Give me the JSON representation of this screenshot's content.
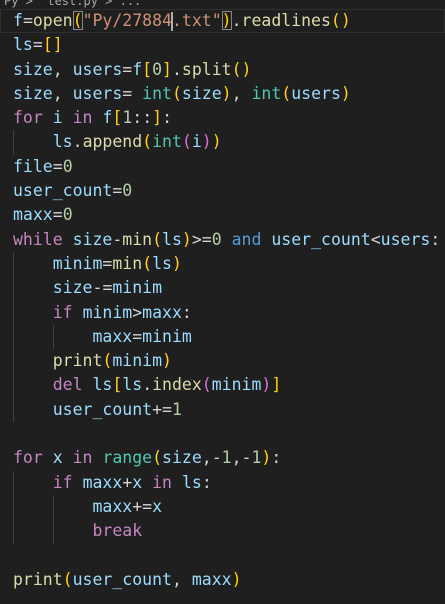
{
  "breadcrumb": {
    "text": "Py >  test.py > ..."
  },
  "editor": {
    "language": "python",
    "lines": [
      "f=open(\"Py/27884.txt\").readlines()",
      "ls=[]",
      "size, users=f[0].split()",
      "size, users= int(size), int(users)",
      "for i in f[1::]:",
      "    ls.append(int(i))",
      "file=0",
      "user_count=0",
      "maxx=0",
      "while size-min(ls)>=0 and user_count<users:",
      "    minim=min(ls)",
      "    size-=minim",
      "    if minim>maxx:",
      "        maxx=minim",
      "    print(minim)",
      "    del ls[ls.index(minim)]",
      "    user_count+=1",
      "",
      "for x in range(size,-1,-1):",
      "    if maxx+x in ls:",
      "        maxx+=x",
      "        break",
      "",
      "print(user_count, maxx)"
    ]
  },
  "colors": {
    "background": "#1f1f1f",
    "keyword": "#c586c0",
    "variable": "#9cdcfe",
    "function": "#dcdcaa",
    "builtin": "#4ec9b0",
    "number": "#b5cea8",
    "string": "#ce9178",
    "bracket_level1": "#ffd700",
    "bracket_level2": "#da70d6",
    "bracket_level3": "#179fff",
    "logical_operator": "#569cd6"
  }
}
